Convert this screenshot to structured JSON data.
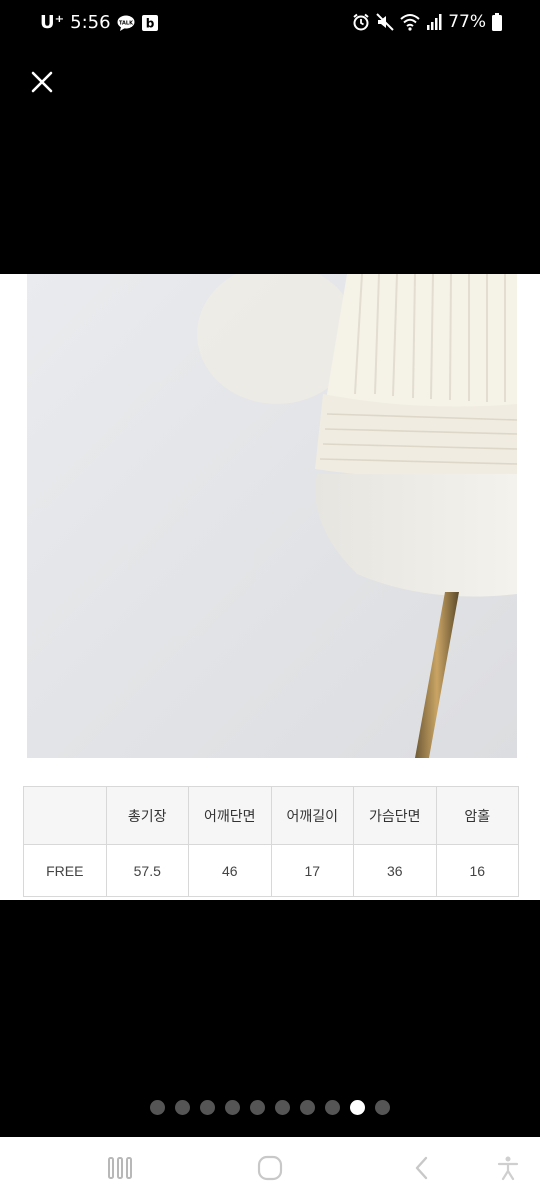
{
  "status_bar": {
    "carrier": "U⁺",
    "time": "5:56",
    "battery": "77%",
    "notification_icons": [
      "talk-icon",
      "b-icon"
    ],
    "system_icons": [
      "alarm-icon",
      "mute-icon",
      "wifi-icon",
      "signal-icon",
      "battery-icon"
    ]
  },
  "viewer": {
    "close_icon": "close-icon"
  },
  "size_table": {
    "headers": [
      "",
      "총기장",
      "어깨단면",
      "어깨길이",
      "가슴단면",
      "암홀"
    ],
    "rows": [
      [
        "FREE",
        "57.5",
        "46",
        "17",
        "36",
        "16"
      ]
    ]
  },
  "pagination": {
    "total": 10,
    "active_index": 8
  },
  "colors": {
    "background": "#000000",
    "sweater": "#f3f0e6",
    "dot_inactive": "#555555",
    "dot_active": "#ffffff"
  }
}
